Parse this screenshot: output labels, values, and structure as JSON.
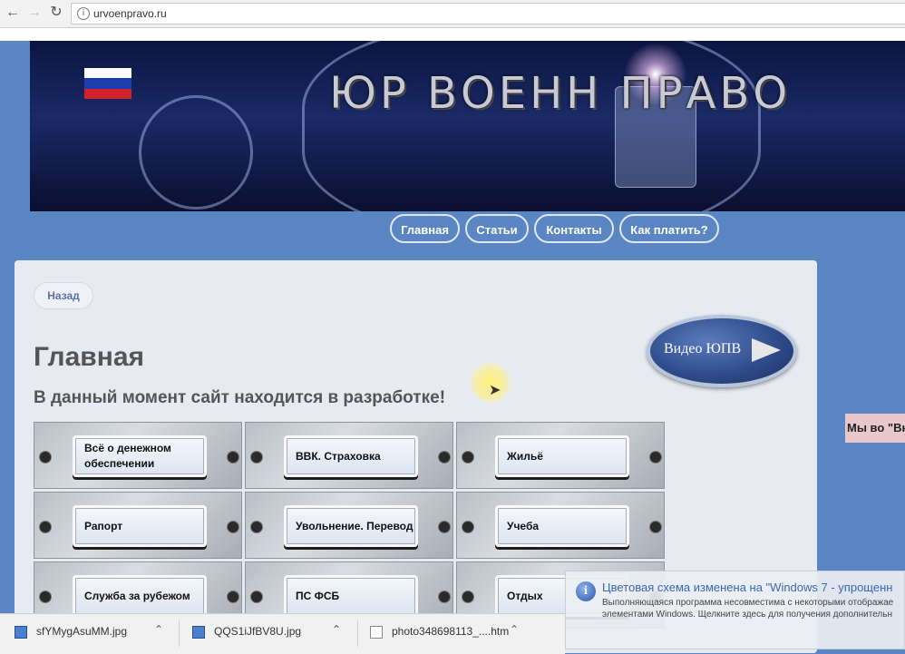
{
  "browser": {
    "url": "urvoenpravo.ru",
    "back_icon": "arrow-left-icon",
    "forward_icon": "arrow-right-icon",
    "reload_icon": "reload-icon",
    "info_glyph": "i"
  },
  "banner": {
    "title": "ЮР ВОЕНН ПРАВО"
  },
  "topnav": {
    "items": [
      {
        "label": "Главная"
      },
      {
        "label": "Статьи"
      },
      {
        "label": "Контакты"
      },
      {
        "label": "Как платить?"
      }
    ]
  },
  "content": {
    "back_label": "Назад",
    "title": "Главная",
    "subtitle": "В данный момент сайт находится в разработке!",
    "video_label": "Видео ЮПВ",
    "tiles": [
      {
        "label": "Всё о денежном обеспечении"
      },
      {
        "label": "ВВК. Страховка"
      },
      {
        "label": "Жильё"
      },
      {
        "label": "Рапорт"
      },
      {
        "label": "Увольнение. Перевод"
      },
      {
        "label": "Учеба"
      },
      {
        "label": "Служба за рубежом"
      },
      {
        "label": "ПС ФСБ"
      },
      {
        "label": "Отдых"
      }
    ]
  },
  "side_note": "Мы во \"Вк",
  "notification": {
    "icon_glyph": "i",
    "title": "Цветовая схема изменена на \"Windows 7 - упрощенн",
    "body_line1": "Выполняющаяся программа несовместима с некоторыми отображае",
    "body_line2": "элементами Windows. Щелкните здесь для получения дополнительн"
  },
  "downloads": [
    {
      "name": "sfYMygAsuMM.jpg"
    },
    {
      "name": "QQS1iJfBV8U.jpg"
    },
    {
      "name": "photo348698113_....htm"
    }
  ],
  "colors": {
    "page_bg": "#5a86c3",
    "card_bg": "#e7ebf1",
    "accent": "#3a66b8"
  }
}
